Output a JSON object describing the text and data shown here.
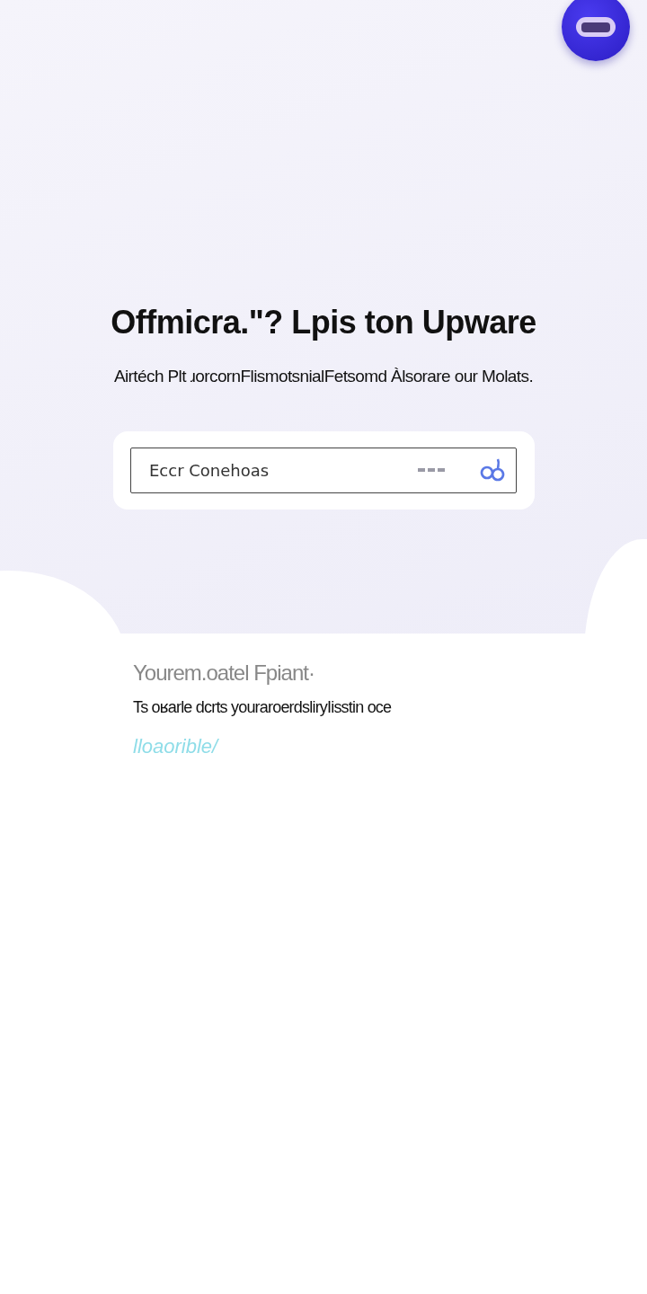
{
  "hero": {
    "title": "Offmicra.\"? Lpis ton Upware",
    "subtitle": "Airtéch Plt ɹorcornFlismotsnialFetsomd Àlsorare our Molats.",
    "search": {
      "placeholder": "Eccr Conehoas"
    }
  },
  "section": {
    "heading": "Yourem.oatel Fpiant·",
    "text": "Ts oʁarle dcrts youraroerdsliryIisstin oce",
    "link": "lloaorible/"
  }
}
